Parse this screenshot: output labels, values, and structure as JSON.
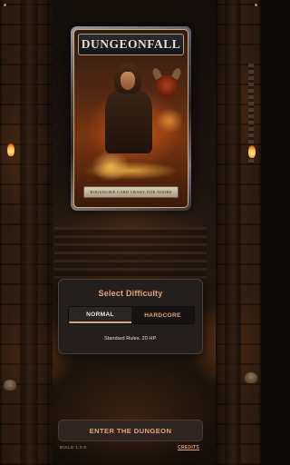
{
  "cover": {
    "title": "DUNGEONFALL",
    "subtitle": "ROGUELIKE CARD CRAWL FOR NOOBS"
  },
  "difficulty": {
    "title": "Select Difficulty",
    "options": [
      "NORMAL",
      "HARDCORE"
    ],
    "selected": "NORMAL",
    "description": "Standard Rules. 20 HP."
  },
  "enter_button": {
    "label": "ENTER THE DUNGEON"
  },
  "footer": {
    "build": "BUILD 1.0.0",
    "credits": "CREDITS"
  },
  "colors": {
    "accent": "#e4a47a",
    "panel_bg": "#24201e",
    "segment_active": "#2a2624",
    "background": "#140e0b"
  },
  "icons": [
    "status-dot-icon",
    "torch-icon",
    "skull-icon"
  ]
}
